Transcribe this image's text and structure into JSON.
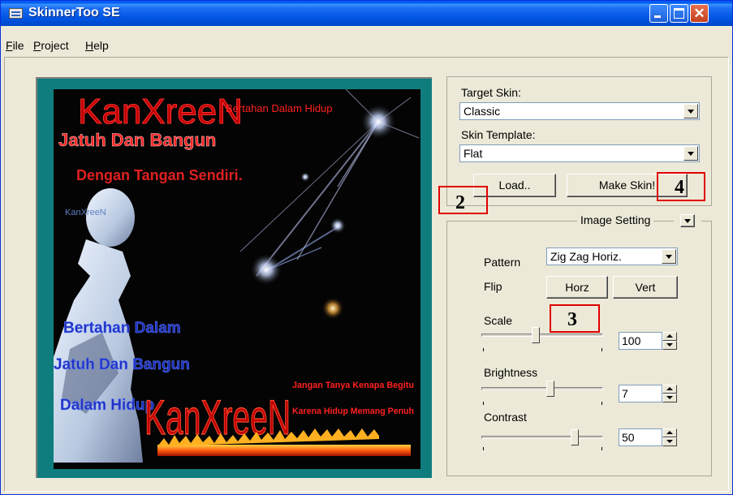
{
  "window": {
    "title": "SkinnerToo SE",
    "minimize_icon": "minimize-icon",
    "maximize_icon": "maximize-icon",
    "close_icon": "close-icon",
    "close_glyph": "✕"
  },
  "menu": {
    "file_underline": "F",
    "file_rest": "ile",
    "project_underline": "P",
    "project_rest": "roject",
    "help_underline": "H",
    "help_rest": "elp"
  },
  "preview": {
    "image": "skin-preview-image",
    "line1": "KanXreeN",
    "line1_small": "Bertahan Dalam Hidup",
    "line2": "Jatuh Dan Bangun",
    "line3": "Dengan Tangan Sendiri.",
    "small_name": "KanXreeN",
    "left_text_1": "Bertahan Dalam",
    "left_text_2": "Jatuh Dan Bangun",
    "left_text_3": "Dalam Hidup",
    "big_name": "KanXreeN",
    "side_text_1": "Jangan Tanya Kenapa Begitu",
    "side_text_2": "Karena Hidup Memang Penuh"
  },
  "target_skin": {
    "label": "Target Skin:",
    "value": "Classic"
  },
  "skin_template": {
    "label": "Skin Template:",
    "value": "Flat"
  },
  "buttons": {
    "load": "Load..",
    "make_skin": "Make Skin!"
  },
  "image_setting": {
    "title": "Image Setting",
    "pattern_label": "Pattern",
    "pattern_value": "Zig Zag Horiz.",
    "flip_label": "Flip",
    "horz": "Horz",
    "vert": "Vert",
    "scale_label": "Scale",
    "scale_value": "100",
    "brightness_label": "Brightness",
    "brightness_value": "7",
    "contrast_label": "Contrast",
    "contrast_value": "50"
  },
  "annotations": {
    "box2": "2",
    "box3": "3",
    "box4": "4",
    "color": "#E00000"
  }
}
